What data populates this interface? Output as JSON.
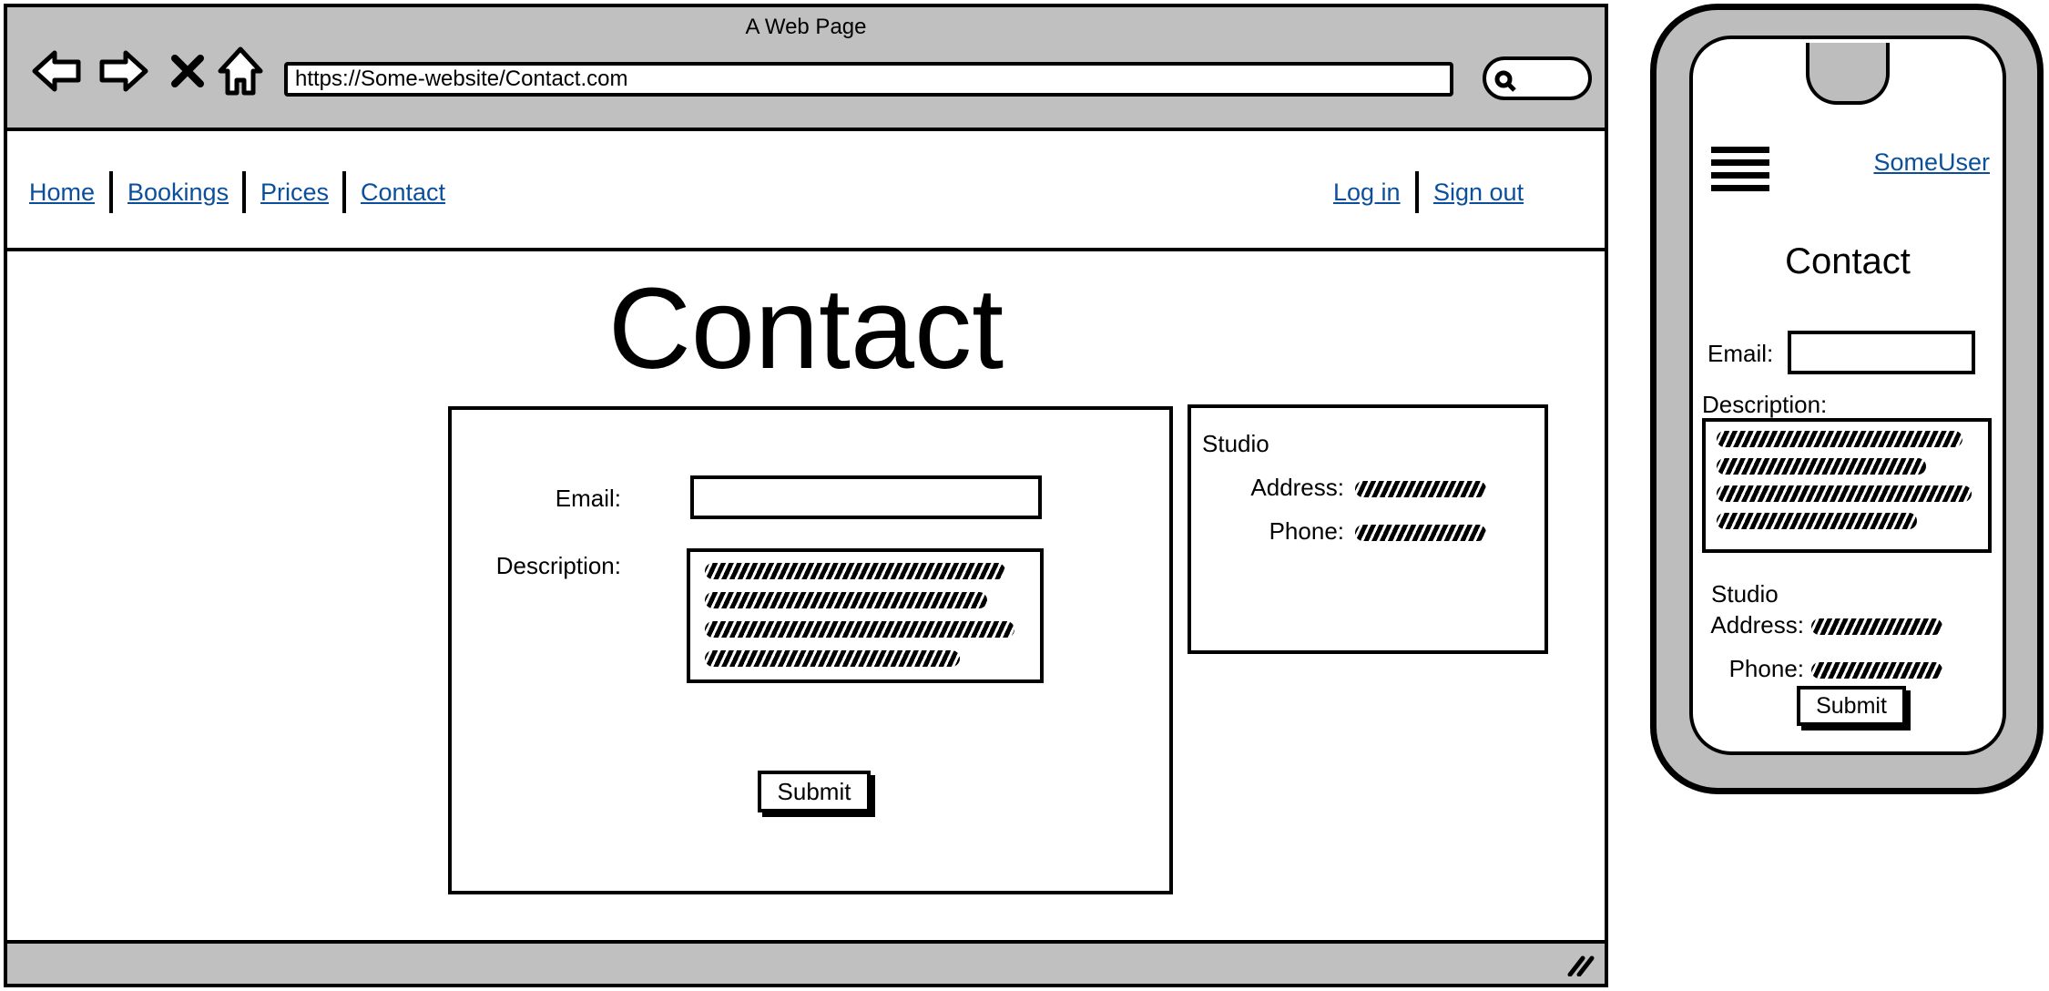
{
  "window": {
    "title": "A Web Page"
  },
  "browser": {
    "url": "https://Some-website/Contact.com",
    "nav_icons": [
      "back-arrow-icon",
      "forward-arrow-icon",
      "close-x-icon",
      "home-icon",
      "search-icon",
      "resize-grip-icon"
    ]
  },
  "nav": {
    "links": [
      {
        "label": "Home"
      },
      {
        "label": "Bookings"
      },
      {
        "label": "Prices"
      },
      {
        "label": "Contact"
      }
    ],
    "auth": {
      "login": "Log in",
      "signout": "Sign out"
    }
  },
  "page": {
    "heading": "Contact",
    "form": {
      "email_label": "Email:",
      "email_value": "",
      "description_label": "Description:",
      "submit_label": "Submit"
    },
    "studio": {
      "title": "Studio",
      "address_label": "Address:",
      "phone_label": "Phone:"
    }
  },
  "phone": {
    "menu_icon": "hamburger-icon",
    "user": "SomeUser",
    "heading": "Contact",
    "email_label": "Email:",
    "description_label": "Description:",
    "studio_title": "Studio",
    "address_label": "Address:",
    "phone_label": "Phone:",
    "submit_label": "Submit"
  },
  "colors": {
    "chrome": "#c0c0c0",
    "link": "#0b4f9c",
    "ink": "#000000"
  }
}
